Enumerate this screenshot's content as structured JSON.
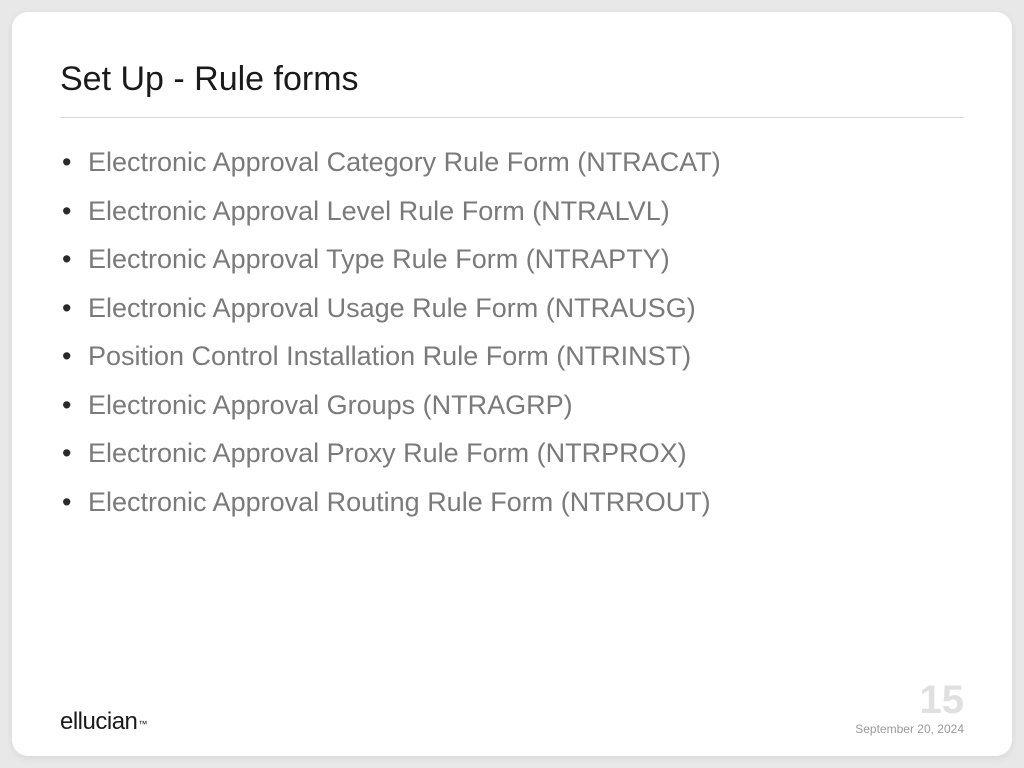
{
  "title": "Set Up - Rule forms",
  "items": [
    "Electronic Approval Category Rule Form (NTRACAT)",
    "Electronic Approval Level Rule Form (NTRALVL)",
    "Electronic Approval Type Rule Form (NTRAPTY)",
    "Electronic Approval Usage Rule Form (NTRAUSG)",
    "Position Control Installation Rule Form (NTRINST)",
    "Electronic Approval Groups (NTRAGRP)",
    "Electronic Approval Proxy Rule Form (NTRPROX)",
    "Electronic Approval Routing Rule Form (NTRROUT)"
  ],
  "footer": {
    "logo": "ellucian",
    "tm": "™",
    "pageNumber": "15",
    "date": "September 20, 2024"
  }
}
